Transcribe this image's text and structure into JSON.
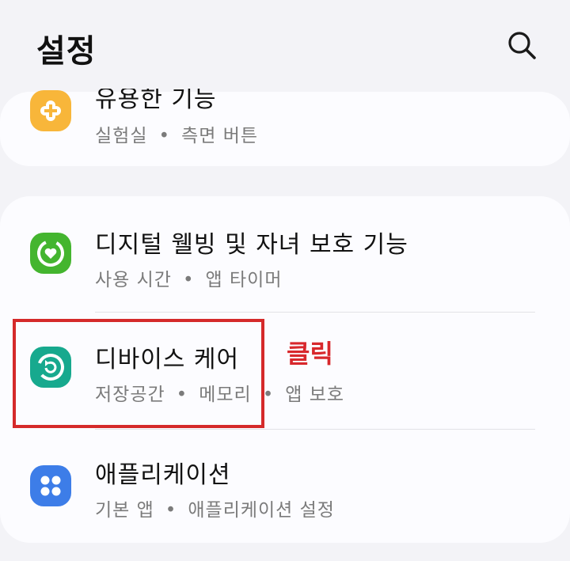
{
  "header": {
    "title": "설정",
    "search_icon": "search-icon"
  },
  "items": [
    {
      "label": "유용한 기능",
      "sub": [
        "실험실",
        "측면 버튼"
      ],
      "icon": "plus-puzzle-icon",
      "color": "#f8b63a"
    },
    {
      "label": "디지털 웰빙 및 자녀 보호 기능",
      "sub": [
        "사용 시간",
        "앱 타이머"
      ],
      "icon": "heart-ring-icon",
      "color": "#44b52f"
    },
    {
      "label": "디바이스 케어",
      "sub": [
        "저장공간",
        "메모리",
        "앱 보호"
      ],
      "icon": "device-care-icon",
      "color": "#17a98e"
    },
    {
      "label": "애플리케이션",
      "sub": [
        "기본 앱",
        "애플리케이션 설정"
      ],
      "icon": "four-dots-icon",
      "color": "#3d7de8"
    }
  ],
  "annotation": {
    "text": "클릭",
    "color": "#d8282c"
  }
}
